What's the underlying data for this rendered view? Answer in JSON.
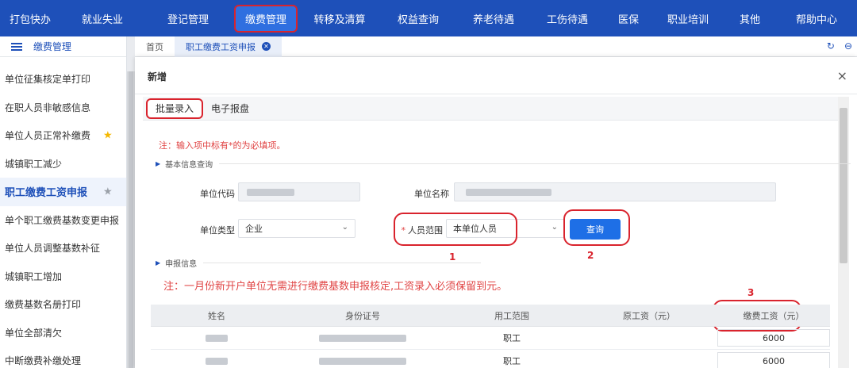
{
  "topnav": {
    "items": [
      "打包快办",
      "就业失业",
      "登记管理",
      "缴费管理",
      "转移及清算",
      "权益查询",
      "养老待遇",
      "工伤待遇",
      "医保",
      "职业培训",
      "其他",
      "帮助中心"
    ],
    "active_index": 3
  },
  "sidebar": {
    "header": "缴费管理",
    "items": [
      {
        "label": "单位征集核定单打印",
        "star": false
      },
      {
        "label": "在职人员非敏感信息",
        "star": false
      },
      {
        "label": "单位人员正常补缴费",
        "star": true,
        "star_color": "#f5b800"
      },
      {
        "label": "城镇职工减少",
        "star": false
      },
      {
        "label": "职工缴费工资申报",
        "star": true,
        "star_color": "#9aa0a8",
        "active": true
      },
      {
        "label": "单个职工缴费基数变更申报",
        "star": false
      },
      {
        "label": "单位人员调整基数补征",
        "star": false
      },
      {
        "label": "城镇职工增加",
        "star": false
      },
      {
        "label": "缴费基数名册打印",
        "star": false
      },
      {
        "label": "单位全部清欠",
        "star": false
      },
      {
        "label": "中断缴费补缴处理",
        "star": false
      }
    ]
  },
  "tabs": {
    "home": "首页",
    "current": "职工缴费工资申报",
    "close_icon": "close-circle-icon",
    "refresh_icon": "↻",
    "more_icon": "⊖"
  },
  "modal": {
    "title": "新增",
    "close": "×",
    "subtabs": [
      "批量录入",
      "电子报盘"
    ],
    "note": "注：输入项中标有*的为必填项。",
    "section_basic": "基本信息查询",
    "section_report": "申报信息",
    "labels": {
      "unit_code": "单位代码",
      "unit_name": "单位名称",
      "unit_type": "单位类型",
      "person_scope": "人员范围"
    },
    "unit_type_value": "企业",
    "person_scope_value": "本单位人员",
    "query_button": "查询",
    "marks": [
      "1",
      "2",
      "3"
    ],
    "big_note": "注：一月份新开户单位无需进行缴费基数申报核定,工资录入必须保留到元。",
    "table": {
      "columns": [
        "姓名",
        "身份证号",
        "用工范围",
        "原工资（元）",
        "缴费工资（元）"
      ],
      "rows": [
        {
          "scope": "职工",
          "salary": "6000"
        },
        {
          "scope": "职工",
          "salary": "6000"
        }
      ]
    }
  },
  "colors": {
    "nav_bg": "#1e50b9",
    "accent": "#1e6fe6",
    "annotation_red": "#d9232d",
    "note_red": "#e04444"
  }
}
